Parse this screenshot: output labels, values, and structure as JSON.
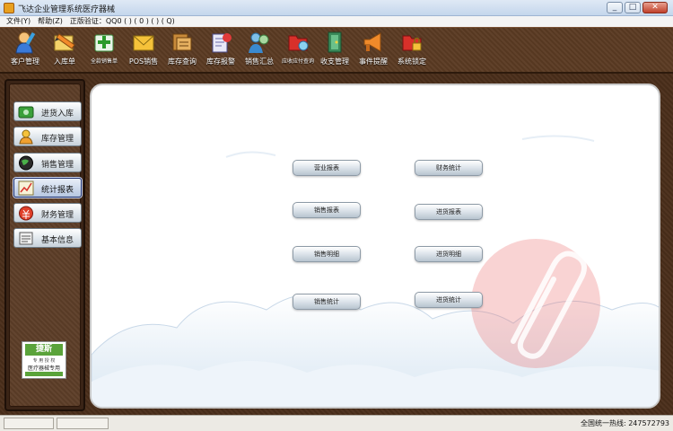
{
  "window": {
    "title": "飞达企业管理系统医疗器械",
    "minimize": "_",
    "maximize": "□",
    "close": "✕"
  },
  "menu": [
    {
      "label": "文件(Y)"
    },
    {
      "label": "帮助(Z)"
    },
    {
      "label": "正版验证：QQ0 ( ) ( 0 ) ( ) ( Q)"
    }
  ],
  "toolbar": [
    {
      "label": "客户管理",
      "icon": "customer-icon"
    },
    {
      "label": "入库单",
      "icon": "inbound-pencil-icon"
    },
    {
      "label": "全款销售单",
      "icon": "sales-order-icon"
    },
    {
      "label": "POS销售",
      "icon": "pos-envelope-icon"
    },
    {
      "label": "库存查询",
      "icon": "inventory-query-icon"
    },
    {
      "label": "库存报警",
      "icon": "inventory-alarm-icon"
    },
    {
      "label": "销售汇总",
      "icon": "sales-summary-icon"
    },
    {
      "label": "应收应付查询",
      "icon": "receivable-icon"
    },
    {
      "label": "收支管理",
      "icon": "finance-door-icon"
    },
    {
      "label": "事件提醒",
      "icon": "event-horn-icon"
    },
    {
      "label": "系统锁定",
      "icon": "lock-icon"
    }
  ],
  "sidebar": [
    {
      "label": "进货入库",
      "icon": "purchase-icon",
      "active": false
    },
    {
      "label": "库存管理",
      "icon": "stock-icon",
      "active": false
    },
    {
      "label": "销售管理",
      "icon": "sales-globe-icon",
      "active": false
    },
    {
      "label": "统计报表",
      "icon": "report-chart-icon",
      "active": true
    },
    {
      "label": "财务管理",
      "icon": "finance-icon",
      "active": false
    },
    {
      "label": "基本信息",
      "icon": "basic-info-icon",
      "active": false
    }
  ],
  "badge": {
    "title": "捷斯",
    "subtitle": "专 用 授 权",
    "text": "医疗器械专用"
  },
  "reports": {
    "left": [
      "营业报表",
      "销售报表",
      "销售明细",
      "销售统计"
    ],
    "right": [
      "财务统计",
      "进货报表",
      "进货明细",
      "进货统计"
    ]
  },
  "status": {
    "hotline": "全国统一热线: 247572793"
  },
  "colors": {
    "frame_brown": "#4a2e1a",
    "active_border": "#1a2c6a",
    "watermark_red": "#e05a5a"
  }
}
